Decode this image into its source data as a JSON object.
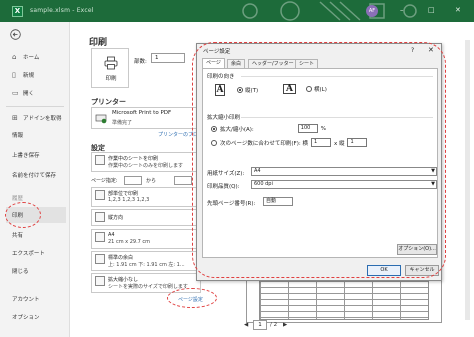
{
  "titlebar": {
    "app_icon": "X",
    "text": "sample.xlsm  -  Excel",
    "avatar": "AF",
    "minimize": "–",
    "maximize": "□",
    "close": "✕"
  },
  "left_nav": {
    "back_icon": "back-arrow-icon",
    "items": [
      {
        "label": "ホーム",
        "icon": "home-icon"
      },
      {
        "label": "新規",
        "icon": "new-doc-icon"
      },
      {
        "label": "開く",
        "icon": "folder-icon"
      },
      {
        "label": "アドインを取得",
        "icon": "grid-icon"
      },
      {
        "label": "情報"
      },
      {
        "label": "上書き保存"
      },
      {
        "label": "名前を付けて保存"
      },
      {
        "label": "履歴"
      },
      {
        "label": "印刷"
      },
      {
        "label": "共有"
      },
      {
        "label": "エクスポート"
      },
      {
        "label": "閉じる"
      },
      {
        "label": "アカウント"
      },
      {
        "label": "オプション"
      }
    ]
  },
  "print": {
    "heading": "印刷",
    "print_button": "印刷",
    "copies_label": "部数:",
    "copies_value": "1",
    "printer_heading": "プリンター",
    "printer_name": "Microsoft Print to PDF",
    "printer_status": "準備完了",
    "printer_props_link": "プリンターのプロパティ",
    "settings_heading": "設定",
    "settings": [
      {
        "line1": "作業中のシートを印刷",
        "line2": "作業中のシートのみを印刷します"
      },
      {
        "line1": "部単位で印刷",
        "line2": "1,2,3    1,2,3    1,2,3"
      },
      {
        "line1": "縦方向",
        "line2": ""
      },
      {
        "line1": "A4",
        "line2": "21 cm x 29.7 cm"
      },
      {
        "line1": "標準の余白",
        "line2": "上: 1.91 cm 下: 1.91 cm 左: 1..."
      },
      {
        "line1": "拡大縮小なし",
        "line2": "シートを実際のサイズで印刷します"
      }
    ],
    "page_range_label": "ページ指定:",
    "page_range_to": "から",
    "page_setup_link": "ページ設定",
    "pager_current": "1",
    "pager_total": "/ 2",
    "pager_prev": "◀",
    "pager_next": "▶"
  },
  "dialog": {
    "title": "ページ設定",
    "help": "?",
    "close": "✕",
    "tabs": [
      "ページ",
      "余白",
      "ヘッダー/フッター",
      "シート"
    ],
    "orientation_label": "印刷の向き",
    "portrait": "縦(T)",
    "landscape": "横(L)",
    "scaling_label": "拡大縮小印刷",
    "zoom_label": "拡大/縮小(A):",
    "zoom_value": "100",
    "zoom_unit": "%",
    "fit_label": "次のページ数に合わせて印刷(F):  横",
    "fit_wide": "1",
    "fit_tall_label": "x 縦",
    "fit_tall": "1",
    "paper_size_label": "用紙サイズ(Z):",
    "paper_size_value": "A4",
    "quality_label": "印刷品質(Q):",
    "quality_value": "600 dpi",
    "first_page_label": "先頭ページ番号(R):",
    "first_page_value": "自動",
    "options_button": "オプション(O)...",
    "ok_button": "OK",
    "cancel_button": "キャンセル"
  },
  "colors": {
    "titlebar": "#1d6b3a",
    "highlight": "#e04040",
    "link": "#2b6cb0"
  }
}
